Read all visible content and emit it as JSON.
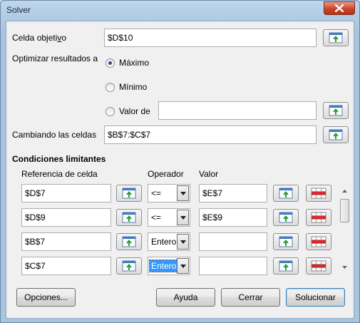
{
  "window": {
    "title": "Solver"
  },
  "objective": {
    "label": "Celda objetivo",
    "label_accel": "v",
    "value": "$D$10"
  },
  "optimize": {
    "label": "Optimizar resultados a",
    "options": [
      {
        "label": "Máximo",
        "checked": true
      },
      {
        "label": "Mínimo",
        "checked": false
      },
      {
        "label": "Valor de",
        "checked": false
      }
    ],
    "value_of": ""
  },
  "changing": {
    "label": "Cambiando las celdas",
    "value": "$B$7:$C$7"
  },
  "constraints": {
    "title": "Condiciones limitantes",
    "col_ref": "Referencia de celda",
    "col_op": "Operador",
    "col_val": "Valor",
    "rows": [
      {
        "ref": "$D$7",
        "op": "<=",
        "val": "$E$7"
      },
      {
        "ref": "$D$9",
        "op": "<=",
        "val": "$E$9"
      },
      {
        "ref": "$B$7",
        "op": "Entero",
        "val": ""
      },
      {
        "ref": "$C$7",
        "op": "Entero",
        "val": ""
      }
    ]
  },
  "buttons": {
    "options": "Opciones...",
    "help": "Ayuda",
    "close": "Cerrar",
    "solve": "Solucionar"
  },
  "icons": {
    "shrink": "shrink-dialog-icon",
    "delete": "delete-row-icon",
    "close": "close-icon",
    "dropdown": "dropdown-arrow-icon"
  }
}
